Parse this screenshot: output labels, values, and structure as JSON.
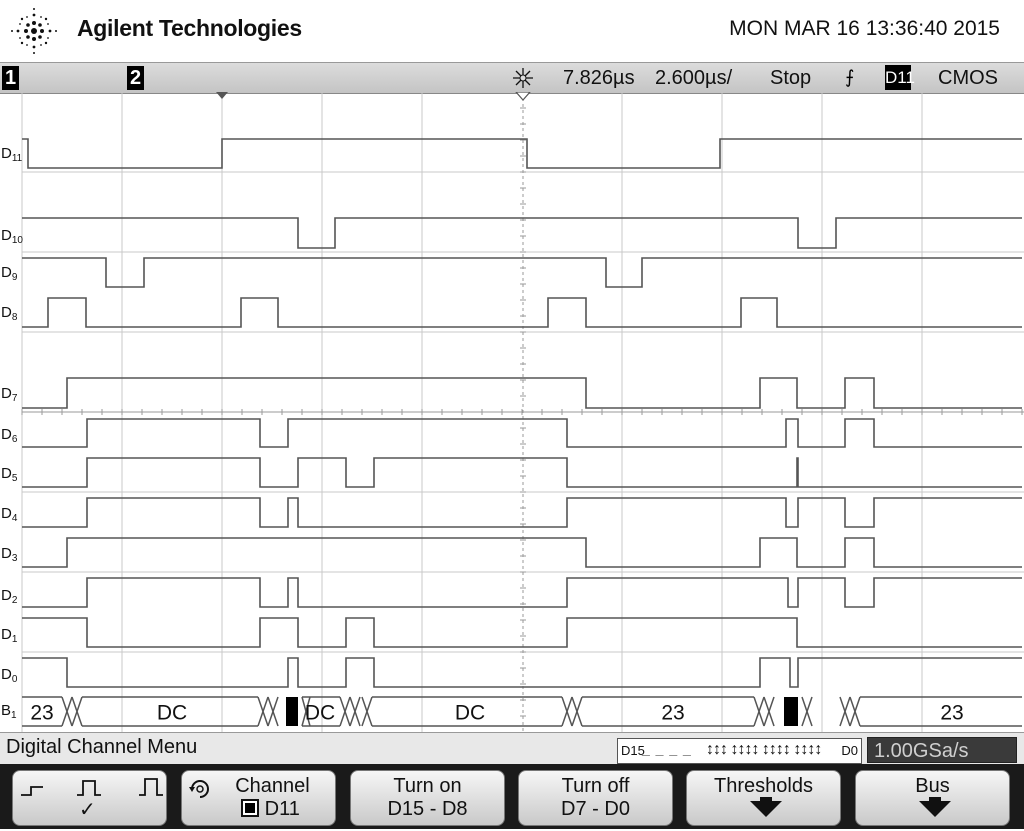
{
  "header": {
    "brand": "Agilent Technologies",
    "datetime": "MON MAR 16 13:36:40 2015"
  },
  "status": {
    "ch1": "1",
    "ch2": "2",
    "trigger_position": "7.826µs",
    "timebase": "2.600µs/",
    "run_state": "Stop",
    "trigger_slope": "⨍",
    "trigger_source": "D11",
    "trigger_level": "CMOS"
  },
  "channels": [
    {
      "name": "D",
      "sub": "11"
    },
    {
      "name": "D",
      "sub": "10"
    },
    {
      "name": "D",
      "sub": "9"
    },
    {
      "name": "D",
      "sub": "8"
    },
    {
      "name": "D",
      "sub": "7"
    },
    {
      "name": "D",
      "sub": "6"
    },
    {
      "name": "D",
      "sub": "5"
    },
    {
      "name": "D",
      "sub": "4"
    },
    {
      "name": "D",
      "sub": "3"
    },
    {
      "name": "D",
      "sub": "2"
    },
    {
      "name": "D",
      "sub": "1"
    },
    {
      "name": "D",
      "sub": "0"
    },
    {
      "name": "B",
      "sub": "1"
    }
  ],
  "bus_values": [
    "23",
    "DC",
    "DC",
    "DC",
    "23",
    "23"
  ],
  "menu": {
    "title": "Digital Channel Menu",
    "channel_bar_start": "D15",
    "channel_bar_dashes": "_ _ _ _",
    "channel_bar_arrows": "↕↕↕ ↕↕↕↕ ↕↕↕↕ ↕↕↕↕",
    "channel_bar_end": "D0",
    "sample_rate": "1.00GSa/s"
  },
  "softkeys": {
    "threshold_check": "✓",
    "channel_label": "Channel",
    "channel_value": "D11",
    "turn_on_l1": "Turn on",
    "turn_on_l2": "D15 - D8",
    "turn_off_l1": "Turn off",
    "turn_off_l2": "D7 - D0",
    "thresholds": "Thresholds",
    "bus": "Bus"
  },
  "colors": {
    "trace": "#555555",
    "grid": "#c8c8c8",
    "center_axis": "#9a9a9a",
    "rate_bg": "#3a3a3a"
  }
}
